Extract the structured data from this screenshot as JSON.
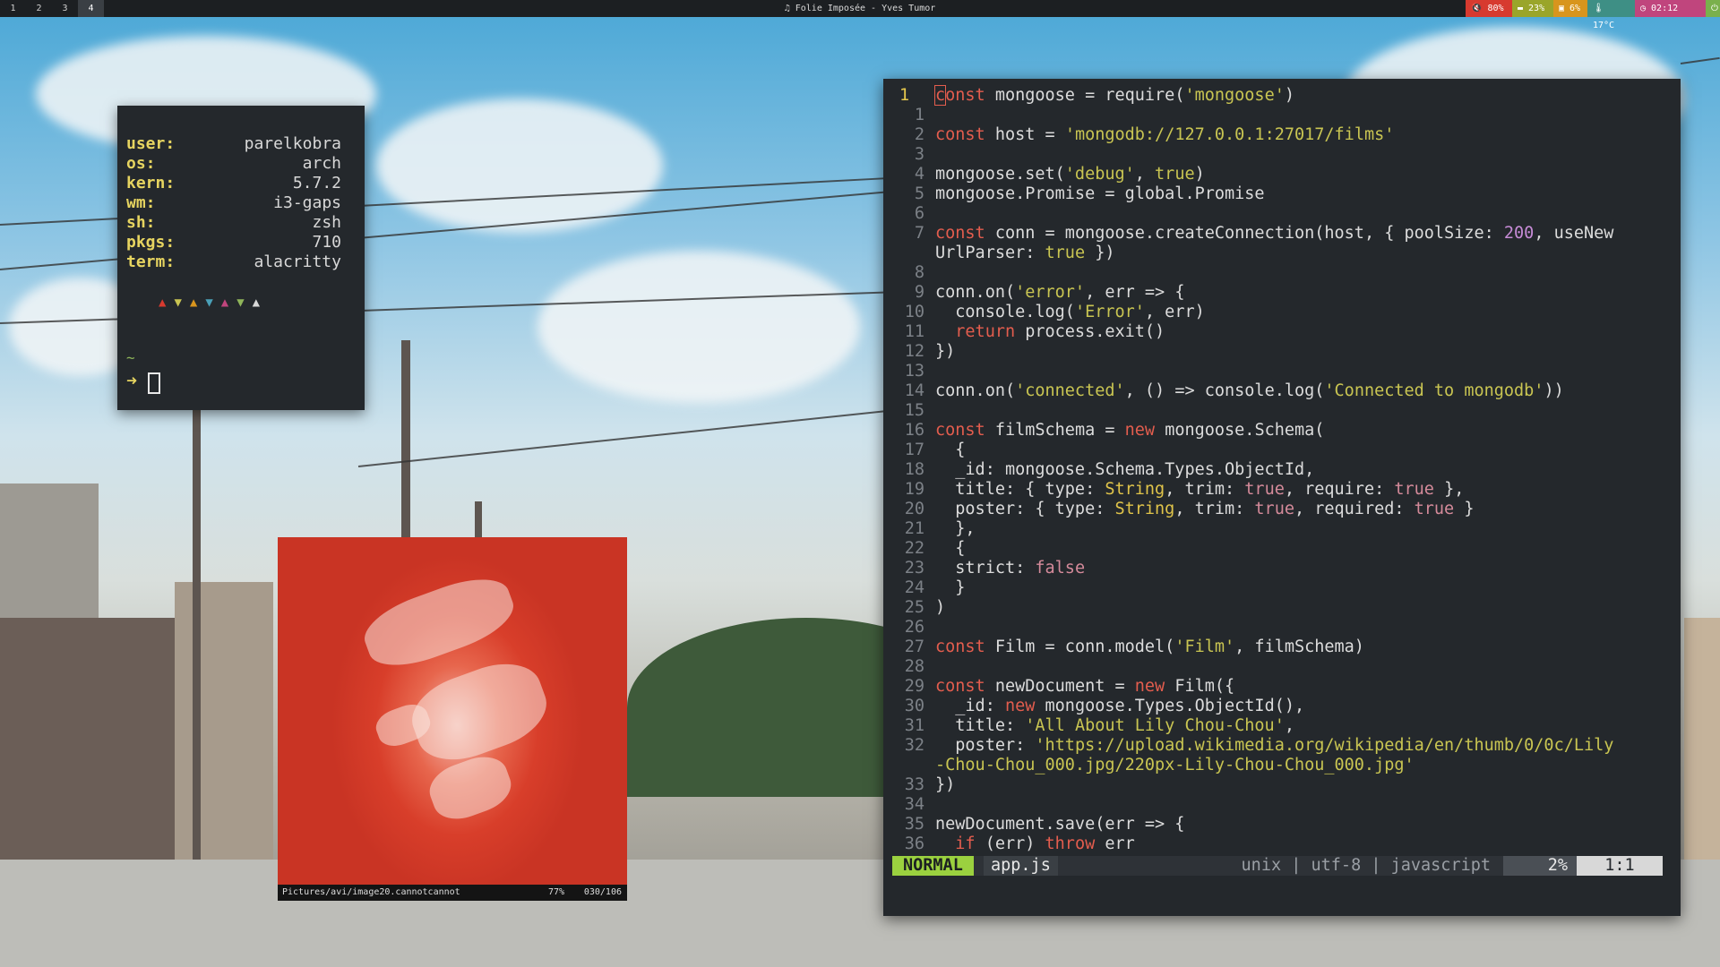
{
  "topbar": {
    "workspaces": [
      "1",
      "2",
      "3",
      "4"
    ],
    "active_workspace": "4",
    "now_playing": "♫ Folie Imposée - Yves Tumor",
    "status": [
      {
        "icon": "volume-icon",
        "text": "🔇 80%",
        "color": "#d73a2f"
      },
      {
        "icon": "cpu-icon",
        "text": "▬ 23%",
        "color": "#9aa52a"
      },
      {
        "icon": "memory-icon",
        "text": "▣ 6%",
        "color": "#d8951d"
      },
      {
        "icon": "temperature-icon",
        "text": "🌡 17°C",
        "color": "#3e8f85"
      },
      {
        "icon": "clock-icon",
        "text": "◷ 02:12",
        "color": "#c0457d"
      },
      {
        "icon": "power-icon",
        "text": "⏻",
        "color": "#7ab04c"
      }
    ]
  },
  "fetch": {
    "rows": [
      {
        "key": "user:",
        "value": "parelkobra"
      },
      {
        "key": "os:",
        "value": "arch"
      },
      {
        "key": "kern:",
        "value": "5.7.2"
      },
      {
        "key": "wm:",
        "value": "i3-gaps"
      },
      {
        "key": "sh:",
        "value": "zsh"
      },
      {
        "key": "pkgs:",
        "value": "710"
      },
      {
        "key": "term:",
        "value": "alacritty"
      }
    ],
    "triangles": [
      "▲",
      "▼",
      "▲",
      "▼",
      "▲",
      "▼",
      "▲"
    ],
    "triangle_colors": [
      "#d73a2f",
      "#c9c552",
      "#d8951d",
      "#4aa0b8",
      "#c0457d",
      "#8fb55a",
      "#d8d8d8"
    ],
    "prompt_dir": "~",
    "prompt_symbol": "➜"
  },
  "viewer": {
    "path": "Pictures/avi/image20.cannotcannot",
    "zoom": "77%",
    "count": "030/106"
  },
  "editor": {
    "lines": [
      {
        "n": "1",
        "cur": true,
        "html": "<span class=\"kw cur-box\">c</span><span class=\"kw\">onst</span> mongoose = require(<span class=\"str\">'mongoose'</span>)"
      },
      {
        "n": "1",
        "html": ""
      },
      {
        "n": "2",
        "html": "<span class=\"kw\">const</span> host = <span class=\"str\">'mongodb://127.0.0.1:27017/films'</span>"
      },
      {
        "n": "3",
        "html": ""
      },
      {
        "n": "4",
        "html": "mongoose.set(<span class=\"str\">'debug'</span>, <span class=\"str\">true</span>)"
      },
      {
        "n": "5",
        "html": "mongoose.Promise = global.Promise"
      },
      {
        "n": "6",
        "html": ""
      },
      {
        "n": "7",
        "html": "<span class=\"kw\">const</span> conn = mongoose.createConnection(host, { poolSize: <span class=\"num\">200</span>, useNew"
      },
      {
        "n": "",
        "html": "UrlParser: <span class=\"str\">true</span> })"
      },
      {
        "n": "8",
        "html": ""
      },
      {
        "n": "9",
        "html": "conn.on(<span class=\"str\">'error'</span>, err =&gt; {"
      },
      {
        "n": "10",
        "html": "  console.log(<span class=\"str\">'Error'</span>, err)"
      },
      {
        "n": "11",
        "html": "  <span class=\"kw\">return</span> process.exit()"
      },
      {
        "n": "12",
        "html": "})"
      },
      {
        "n": "13",
        "html": ""
      },
      {
        "n": "14",
        "html": "conn.on(<span class=\"str\">'connected'</span>, () =&gt; console.log(<span class=\"str\">'Connected to mongodb'</span>))"
      },
      {
        "n": "15",
        "html": ""
      },
      {
        "n": "16",
        "html": "<span class=\"kw\">const</span> filmSchema = <span class=\"kw\">new</span> mongoose.Schema("
      },
      {
        "n": "17",
        "html": "  {"
      },
      {
        "n": "18",
        "html": "  _id: mongoose.Schema.Types.ObjectId,"
      },
      {
        "n": "19",
        "html": "  title: { type: <span class=\"type\">String</span>, trim: <span class=\"bool\">true</span>, require: <span class=\"bool\">true</span> },"
      },
      {
        "n": "20",
        "html": "  poster: { type: <span class=\"type\">String</span>, trim: <span class=\"bool\">true</span>, required: <span class=\"bool\">true</span> }"
      },
      {
        "n": "21",
        "html": "  },"
      },
      {
        "n": "22",
        "html": "  {"
      },
      {
        "n": "23",
        "html": "  strict: <span class=\"bool\">false</span>"
      },
      {
        "n": "24",
        "html": "  }"
      },
      {
        "n": "25",
        "html": ")"
      },
      {
        "n": "26",
        "html": ""
      },
      {
        "n": "27",
        "html": "<span class=\"kw\">const</span> Film = conn.model(<span class=\"str\">'Film'</span>, filmSchema)"
      },
      {
        "n": "28",
        "html": ""
      },
      {
        "n": "29",
        "html": "<span class=\"kw\">const</span> newDocument = <span class=\"kw\">new</span> Film({"
      },
      {
        "n": "30",
        "html": "  _id: <span class=\"kw\">new</span> mongoose.Types.ObjectId(),"
      },
      {
        "n": "31",
        "html": "  title: <span class=\"str\">'All About Lily Chou-Chou'</span>,"
      },
      {
        "n": "32",
        "html": "  poster: <span class=\"str\">'https://upload.wikimedia.org/wikipedia/en/thumb/0/0c/Lily</span>"
      },
      {
        "n": "",
        "html": "<span class=\"str\">-Chou-Chou_000.jpg/220px-Lily-Chou-Chou_000.jpg'</span>"
      },
      {
        "n": "33",
        "html": "})"
      },
      {
        "n": "34",
        "html": ""
      },
      {
        "n": "35",
        "html": "newDocument.save(err =&gt; {"
      },
      {
        "n": "36",
        "html": "  <span class=\"kw\">if</span> (err) <span class=\"kw\">throw</span> err"
      }
    ],
    "statusline": {
      "mode": "NORMAL",
      "filename": "app.js",
      "fileinfo": "unix | utf-8 | javascript",
      "percent": "2%",
      "position": "1:1"
    }
  }
}
